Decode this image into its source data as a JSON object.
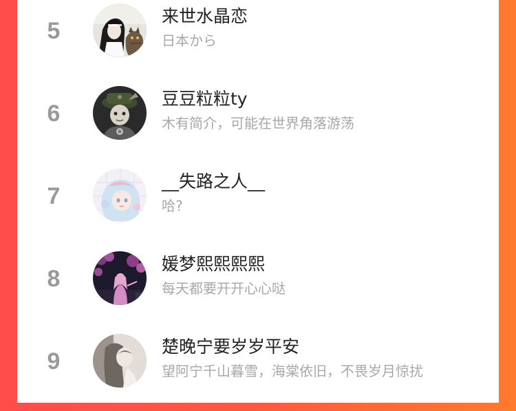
{
  "users": [
    {
      "rank": "5",
      "name": "来世水晶恋",
      "bio": "日本から",
      "avatar": "avatar-ink-portrait-cat"
    },
    {
      "rank": "6",
      "name": "豆豆粒粒ty",
      "bio": "木有简介，可能在世界角落游荡",
      "avatar": "avatar-dark-hat-character"
    },
    {
      "rank": "7",
      "name": "__失路之人__",
      "bio": "哈?",
      "avatar": "avatar-pastel-anime-girl"
    },
    {
      "rank": "8",
      "name": "媛梦熙熙熙熙",
      "bio": "每天都要开开心心哒",
      "avatar": "avatar-night-blossom-figure"
    },
    {
      "rank": "9",
      "name": "楚晚宁要岁岁平安",
      "bio": "望阿宁千山暮雪，海棠依旧，不畏岁月惊扰",
      "avatar": "avatar-grey-photo"
    }
  ],
  "colors": {
    "background_left": "#ff4d4a",
    "background_right": "#ff7a2e",
    "rank": "#9a9a9a",
    "name": "#222222",
    "bio": "#a8a8a8"
  }
}
